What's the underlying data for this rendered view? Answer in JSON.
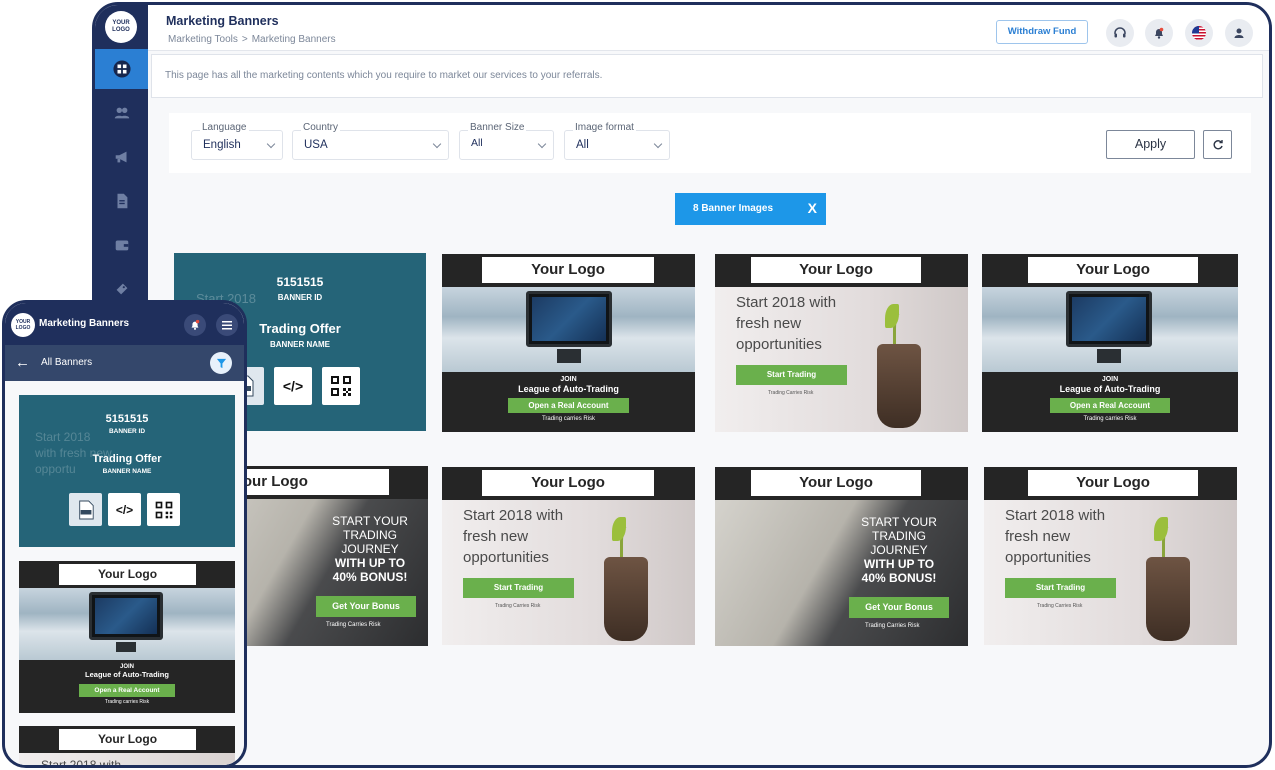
{
  "desktop": {
    "sidebar": {
      "logo_text": "YOUR LOGO",
      "items": [
        "dashboard-icon",
        "users-icon",
        "megaphone-icon",
        "document-icon",
        "wallet-icon",
        "ticket-icon"
      ]
    },
    "header": {
      "title": "Marketing Banners",
      "breadcrumb": [
        "Marketing Tools",
        ">",
        "Marketing Banners"
      ],
      "withdraw_label": "Withdraw Fund",
      "icons": [
        "headset-icon",
        "bell-icon",
        "us-flag-icon",
        "user-icon"
      ]
    },
    "info_text": "This page has all the marketing contents which you require to market our services to your referrals.",
    "filters": [
      {
        "label": "Language",
        "value": "English"
      },
      {
        "label": "Country",
        "value": "USA"
      },
      {
        "label": "Banner Size",
        "value": "All"
      },
      {
        "label": "Image format",
        "value": "All"
      }
    ],
    "apply_label": "Apply",
    "result_count": "8 Banner Images",
    "result_close": "X",
    "hover_overlay": {
      "banner_id": "5151515",
      "banner_id_label": "BANNER ID",
      "banner_name": "Trading Offer",
      "banner_name_label": "BANNER NAME",
      "code_glyph": "</>",
      "bg_text": "Start 2018"
    },
    "banners": {
      "logo": "Your Logo",
      "join": "JOIN",
      "league": "League of Auto-Trading",
      "open_account": "Open a Real Account",
      "risk_lower": "Trading carries Risk",
      "start_l1": "Start 2018 with",
      "start_l2": "fresh new",
      "start_l3": "opportunities",
      "start_trading": "Start Trading",
      "risk_caps": "Trading Carries Risk",
      "journey_l1": "START YOUR",
      "journey_l2": "TRADING JOURNEY",
      "journey_l3": "WITH UP TO",
      "journey_l4": "40% BONUS!",
      "get_bonus": "Get Your Bonus"
    }
  },
  "mobile": {
    "logo_text": "YOUR LOGO",
    "title": "Marketing Banners",
    "subheader": "All Banners",
    "overlay_id": "5151515",
    "overlay_id_label": "BANNER ID",
    "overlay_name": "Trading Offer",
    "overlay_name_label": "BANNER NAME",
    "overlay_bg_text": "Start 2018 with fresh new opportu",
    "logo": "Your Logo",
    "join": "JOIN",
    "league": "League of Auto-Trading",
    "open_account": "Open a Real Account",
    "risk": "Trading carries Risk",
    "partial_text": "Start 2018 with"
  }
}
